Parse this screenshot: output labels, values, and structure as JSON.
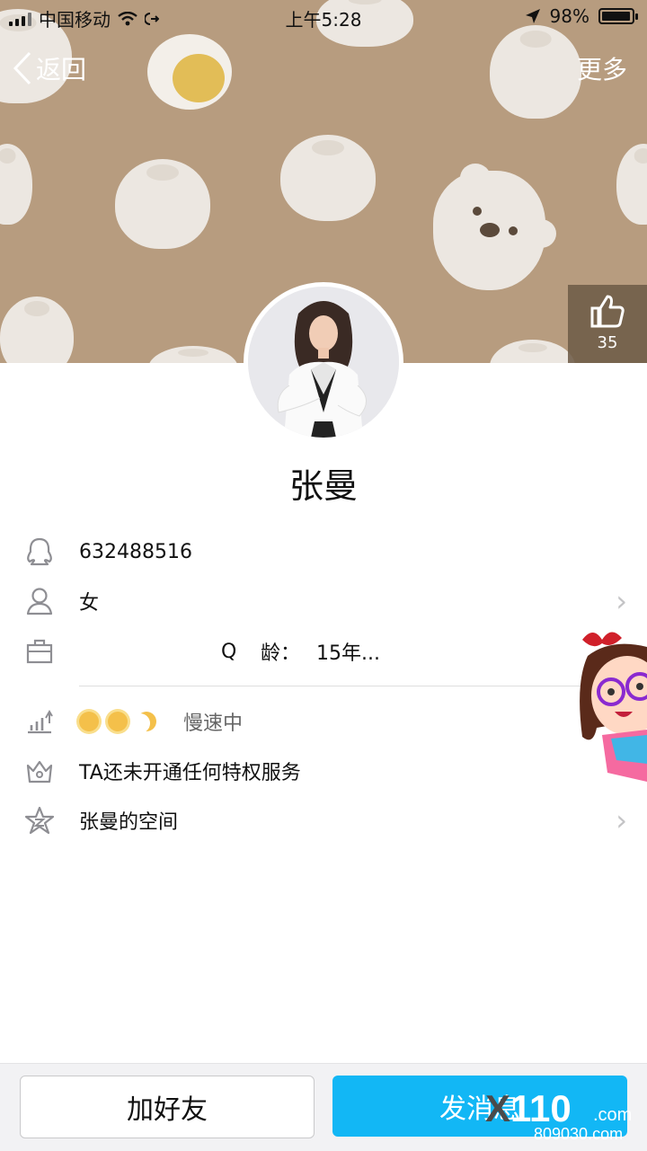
{
  "status_bar": {
    "carrier": "中国移动",
    "time": "上午5:28",
    "battery_percent": "98%",
    "battery_level": 0.98
  },
  "nav": {
    "back_label": "返回",
    "more_label": "更多"
  },
  "profile": {
    "likes": "35",
    "name": "张曼"
  },
  "info": {
    "qq_number": "632488516",
    "gender": "女",
    "q_label": "Q",
    "age_label": "龄：",
    "age_value": "15年..."
  },
  "extra": {
    "speed": "慢速中",
    "privilege": "TA还未开通任何特权服务",
    "space": "张曼的空间"
  },
  "bottom": {
    "add_friend": "加好友",
    "send_message": "发消息"
  },
  "watermark": {
    "main": "110",
    "x_char": "X",
    "domain": ".com",
    "sub": "809030.com"
  },
  "colors": {
    "cover_bg": "#b79c7f",
    "primary_button": "#12b7f5"
  }
}
